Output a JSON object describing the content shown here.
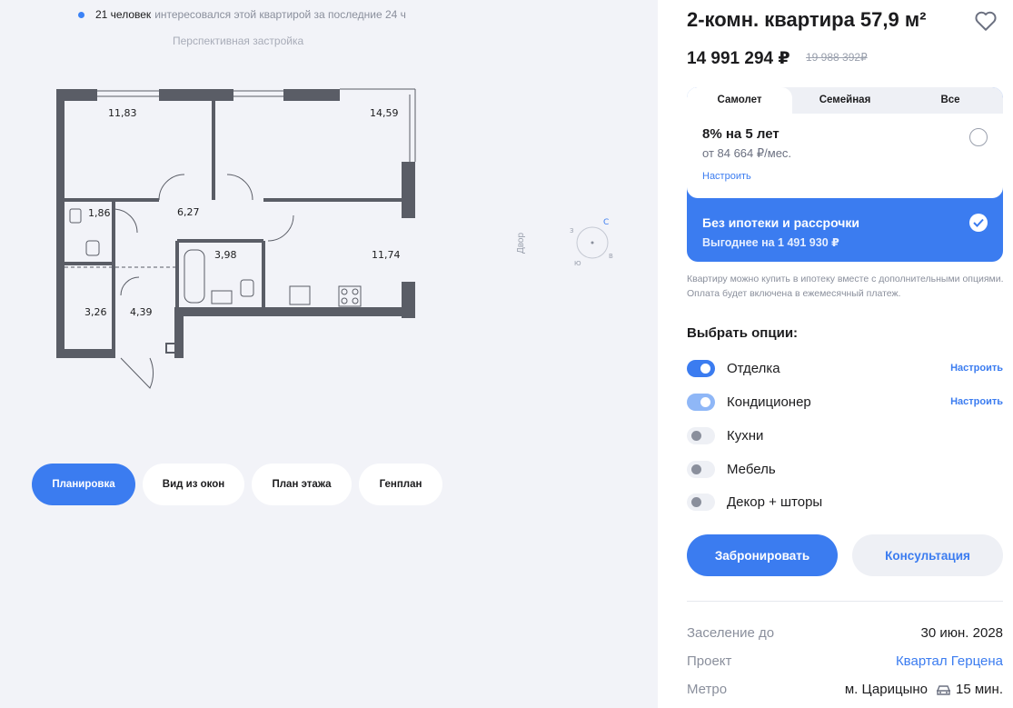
{
  "viewers": {
    "count": "21 человек",
    "text": "интересовался этой квартирой за последние 24 ч"
  },
  "perspective": "Перспективная застройка",
  "floorplan": {
    "rooms": [
      "11,83",
      "14,59",
      "1,86",
      "6,27",
      "3,98",
      "11,74",
      "3,26",
      "4,39"
    ],
    "yard_label": "Двор",
    "compass": {
      "n": "С",
      "s": "Ю",
      "e": "В",
      "w": "З"
    }
  },
  "view_tabs": [
    "Планировка",
    "Вид из окон",
    "План этажа",
    "Генплан"
  ],
  "apartment": {
    "title": "2-комн. квартира 57,9 м²",
    "price": "14 991 294 ₽",
    "old_price": "19 988 392₽"
  },
  "mortgage": {
    "tabs": [
      "Самолет",
      "Семейная",
      "Все"
    ],
    "rate": "8% на 5 лет",
    "monthly": "от 84 664 ₽/мес.",
    "setup": "Настроить",
    "cash_title": "Без ипотеки и рассрочки",
    "cash_sub": "Выгоднее на 1 491 930 ₽"
  },
  "note": "Квартиру можно купить в ипотеку вместе с дополнительными опциями. Оплата будет включена в ежемесячный платеж.",
  "options": {
    "title": "Выбрать опции:",
    "items": [
      {
        "label": "Отделка",
        "setup": "Настроить"
      },
      {
        "label": "Кондиционер",
        "setup": "Настроить"
      },
      {
        "label": "Кухни",
        "setup": ""
      },
      {
        "label": "Мебель",
        "setup": ""
      },
      {
        "label": "Декор + шторы",
        "setup": ""
      }
    ]
  },
  "buttons": {
    "book": "Забронировать",
    "consult": "Консультация"
  },
  "info": {
    "settle_label": "Заселение до",
    "settle_value": "30 июн. 2028",
    "project_label": "Проект",
    "project_value": "Квартал Герцена",
    "metro_label": "Метро",
    "metro_value": "м. Царицыно",
    "metro_time": "15 мин."
  },
  "colors": {
    "accent": "#3b7cf0",
    "background": "#f2f3f8"
  }
}
